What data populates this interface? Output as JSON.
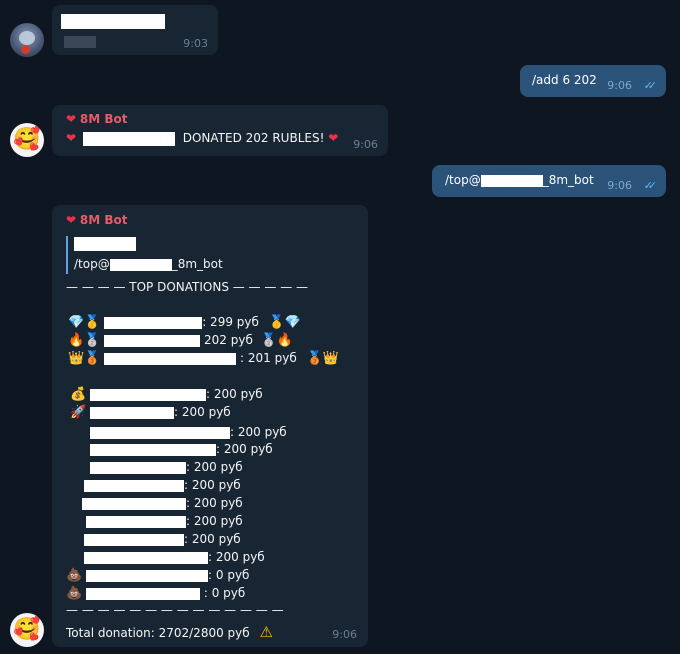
{
  "messages": {
    "m1": {
      "time": "9:03"
    },
    "m2": {
      "text": "/add 6 202",
      "time": "9:06",
      "checks": "✓✓"
    },
    "m3": {
      "sender": "8M Bot",
      "heart": "❤",
      "text": "DONATED 202 RUBLES!",
      "time": "9:06"
    },
    "m4": {
      "text_prefix": "/top@",
      "text_suffix": "_8m_bot",
      "time": "9:06",
      "checks": "✓✓"
    },
    "m5": {
      "sender": "8M Bot",
      "heart": "❤",
      "quote_prefix": "/top@",
      "quote_suffix": "_8m_bot",
      "header": "— — — — TOP DONATIONS — — — — —",
      "top3": [
        {
          "left": "💎🥇",
          "amount": ": 299 руб",
          "right": "🥇💎"
        },
        {
          "left": "🔥🥈",
          "amount": "202 руб",
          "right": "🥈🔥"
        },
        {
          "left": "👑🥉",
          "amount": ": 201 руб",
          "right": "🥉👑"
        }
      ],
      "list": [
        {
          "icon": "💰",
          "amount": ": 200 руб"
        },
        {
          "icon": "🚀",
          "amount": ": 200 руб"
        },
        {
          "icon": "",
          "amount": ": 200 руб"
        },
        {
          "icon": "",
          "amount": ": 200 руб"
        },
        {
          "icon": "",
          "amount": ": 200 руб"
        },
        {
          "icon": "",
          "amount": ": 200 руб"
        },
        {
          "icon": "",
          "amount": ": 200 руб"
        },
        {
          "icon": "",
          "amount": ": 200 руб"
        },
        {
          "icon": "",
          "amount": ": 200 руб"
        },
        {
          "icon": "",
          "amount": ": 200 руб"
        },
        {
          "icon": "💩",
          "amount": ": 0 руб"
        },
        {
          "icon": "💩",
          "amount": ": 0 руб"
        }
      ],
      "footer_dashes": "— — — — — — — — — — — — — —",
      "total": "Total donation:  2702/2800 руб",
      "warning": "⚠",
      "time": "9:06"
    }
  },
  "colors": {
    "bg": "#0e1621",
    "incoming": "#182533",
    "outgoing": "#2b5278",
    "sender": "#e95a6b",
    "quote_bar": "#5ea1e6",
    "checks": "#63b4f2"
  }
}
